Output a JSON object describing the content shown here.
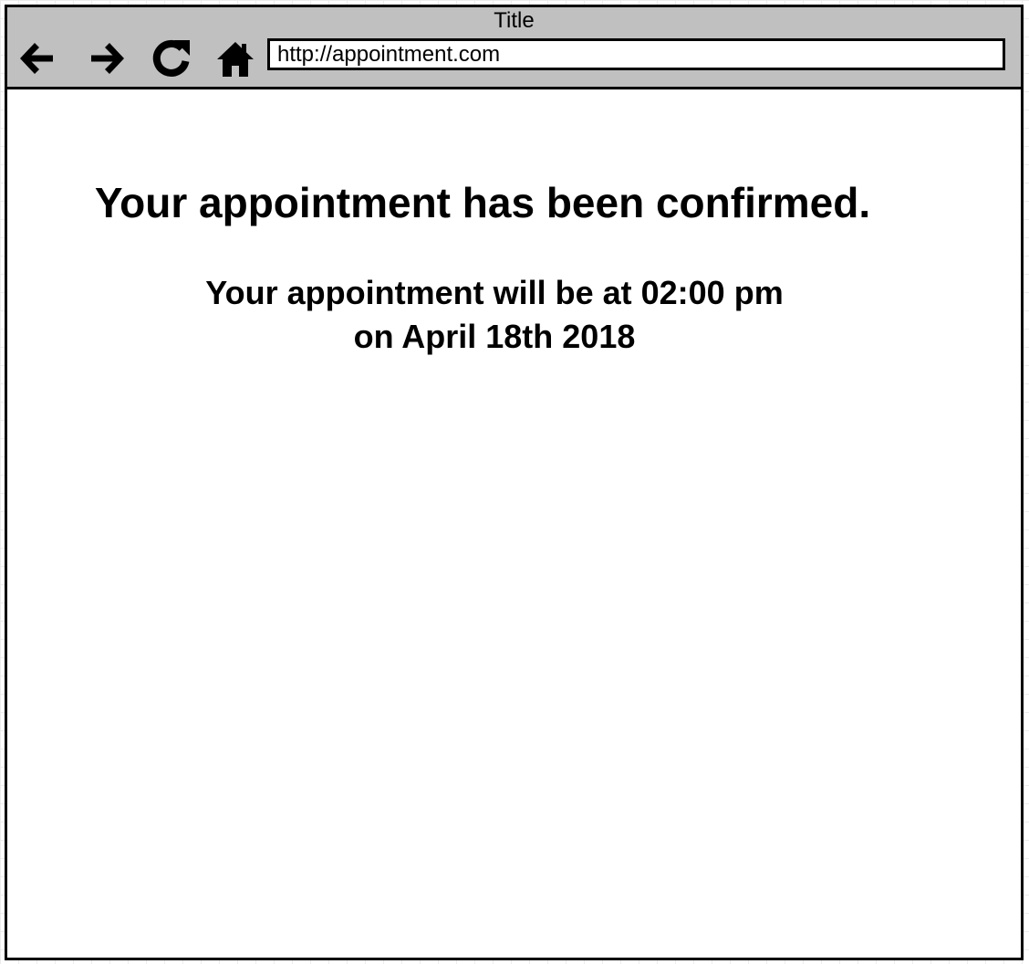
{
  "window": {
    "title": "Title"
  },
  "toolbar": {
    "back_icon": "arrow-left-icon",
    "forward_icon": "arrow-right-icon",
    "reload_icon": "reload-icon",
    "home_icon": "home-icon",
    "address_value": "http://appointment.com"
  },
  "main": {
    "heading": "Your appointment has been confirmed.",
    "time_line": "Your appointment will be at 02:00 pm",
    "date_line": "on April 18th 2018"
  },
  "colors": {
    "toolbar_background": "#c0c0c0",
    "border": "#000000",
    "text": "#000000"
  }
}
